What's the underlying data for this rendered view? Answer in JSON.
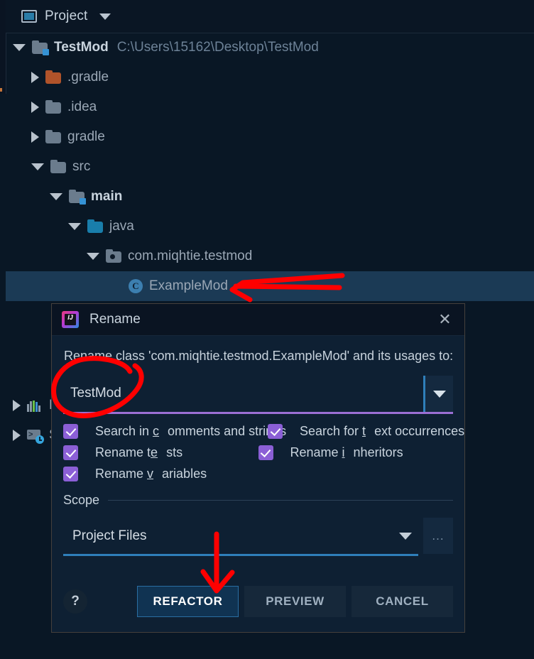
{
  "toolwindow": {
    "title": "Project",
    "icon": "project-window-icon",
    "dropdown_icon": "chevron-down-icon"
  },
  "tree": {
    "items": [
      {
        "label": "TestMod",
        "path": "C:\\Users\\15162\\Desktop\\TestMod",
        "icon": "module-folder-icon",
        "state": "expanded",
        "depth": 0,
        "bold": true,
        "selected": false
      },
      {
        "label": ".gradle",
        "path": "",
        "icon": "folder-orange-icon",
        "state": "collapsed",
        "depth": 1,
        "bold": false,
        "selected": false
      },
      {
        "label": ".idea",
        "path": "",
        "icon": "folder-grey-icon",
        "state": "collapsed",
        "depth": 1,
        "bold": false,
        "selected": false
      },
      {
        "label": "gradle",
        "path": "",
        "icon": "folder-grey-icon",
        "state": "collapsed",
        "depth": 1,
        "bold": false,
        "selected": false
      },
      {
        "label": "src",
        "path": "",
        "icon": "folder-grey-icon",
        "state": "expanded",
        "depth": 1,
        "bold": false,
        "selected": false
      },
      {
        "label": "main",
        "path": "",
        "icon": "module-folder-icon",
        "state": "expanded",
        "depth": 2,
        "bold": true,
        "selected": false
      },
      {
        "label": "java",
        "path": "",
        "icon": "folder-source-blue-icon",
        "state": "expanded",
        "depth": 3,
        "bold": false,
        "selected": false
      },
      {
        "label": "com.miqhtie.testmod",
        "path": "",
        "icon": "package-icon",
        "state": "expanded",
        "depth": 4,
        "bold": false,
        "selected": false
      },
      {
        "label": "ExampleMod",
        "path": "",
        "icon": "java-class-icon",
        "state": "leaf",
        "depth": 5,
        "bold": false,
        "selected": true
      }
    ],
    "hidden_items": [
      {
        "label": "B",
        "icon": "build-variants-icon",
        "state": "collapsed"
      },
      {
        "label": "S",
        "icon": "scratches-consoles-icon",
        "state": "collapsed"
      }
    ]
  },
  "dialog": {
    "title": "Rename",
    "app_icon": "intellij-idea-icon",
    "app_icon_text": "IJ",
    "close_icon": "close-icon",
    "prompt": "Rename class 'com.miqhtie.testmod.ExampleMod' and its usages to:",
    "name_field": {
      "value": "TestMod",
      "placeholder": "",
      "dropdown_icon": "chevron-down-icon",
      "underline_color": "#9b6fd4"
    },
    "checkboxes": [
      {
        "label_pre": "Search in ",
        "mnemonic": "c",
        "label_post": "omments and strings",
        "checked": true,
        "name": "search-in-comments-and-strings"
      },
      {
        "label_pre": "Search for ",
        "mnemonic": "t",
        "label_post": "ext occurrences",
        "checked": true,
        "name": "search-for-text-occurrences"
      },
      {
        "label_pre": "Rename t",
        "mnemonic": "e",
        "label_post": "sts",
        "checked": true,
        "name": "rename-tests"
      },
      {
        "label_pre": "Rename ",
        "mnemonic": "i",
        "label_post": "nheritors",
        "checked": true,
        "name": "rename-inheritors"
      },
      {
        "label_pre": "Rename ",
        "mnemonic": "v",
        "label_post": "ariables",
        "checked": true,
        "name": "rename-variables"
      }
    ],
    "scope": {
      "section_label": "Scope",
      "value": "Project Files",
      "dropdown_icon": "chevron-down-icon",
      "more_label": "...",
      "underline_color": "#2f7fba"
    },
    "buttons": {
      "help": "?",
      "refactor": "REFACTOR",
      "preview": "PREVIEW",
      "cancel": "CANCEL"
    }
  },
  "annotations": {
    "color": "#ff0000",
    "marks": [
      {
        "name": "arrow-to-examplemod",
        "type": "left-arrow"
      },
      {
        "name": "circle-around-testmod-field",
        "type": "circle"
      },
      {
        "name": "arrow-to-refactor-button",
        "type": "down-arrow"
      }
    ]
  }
}
